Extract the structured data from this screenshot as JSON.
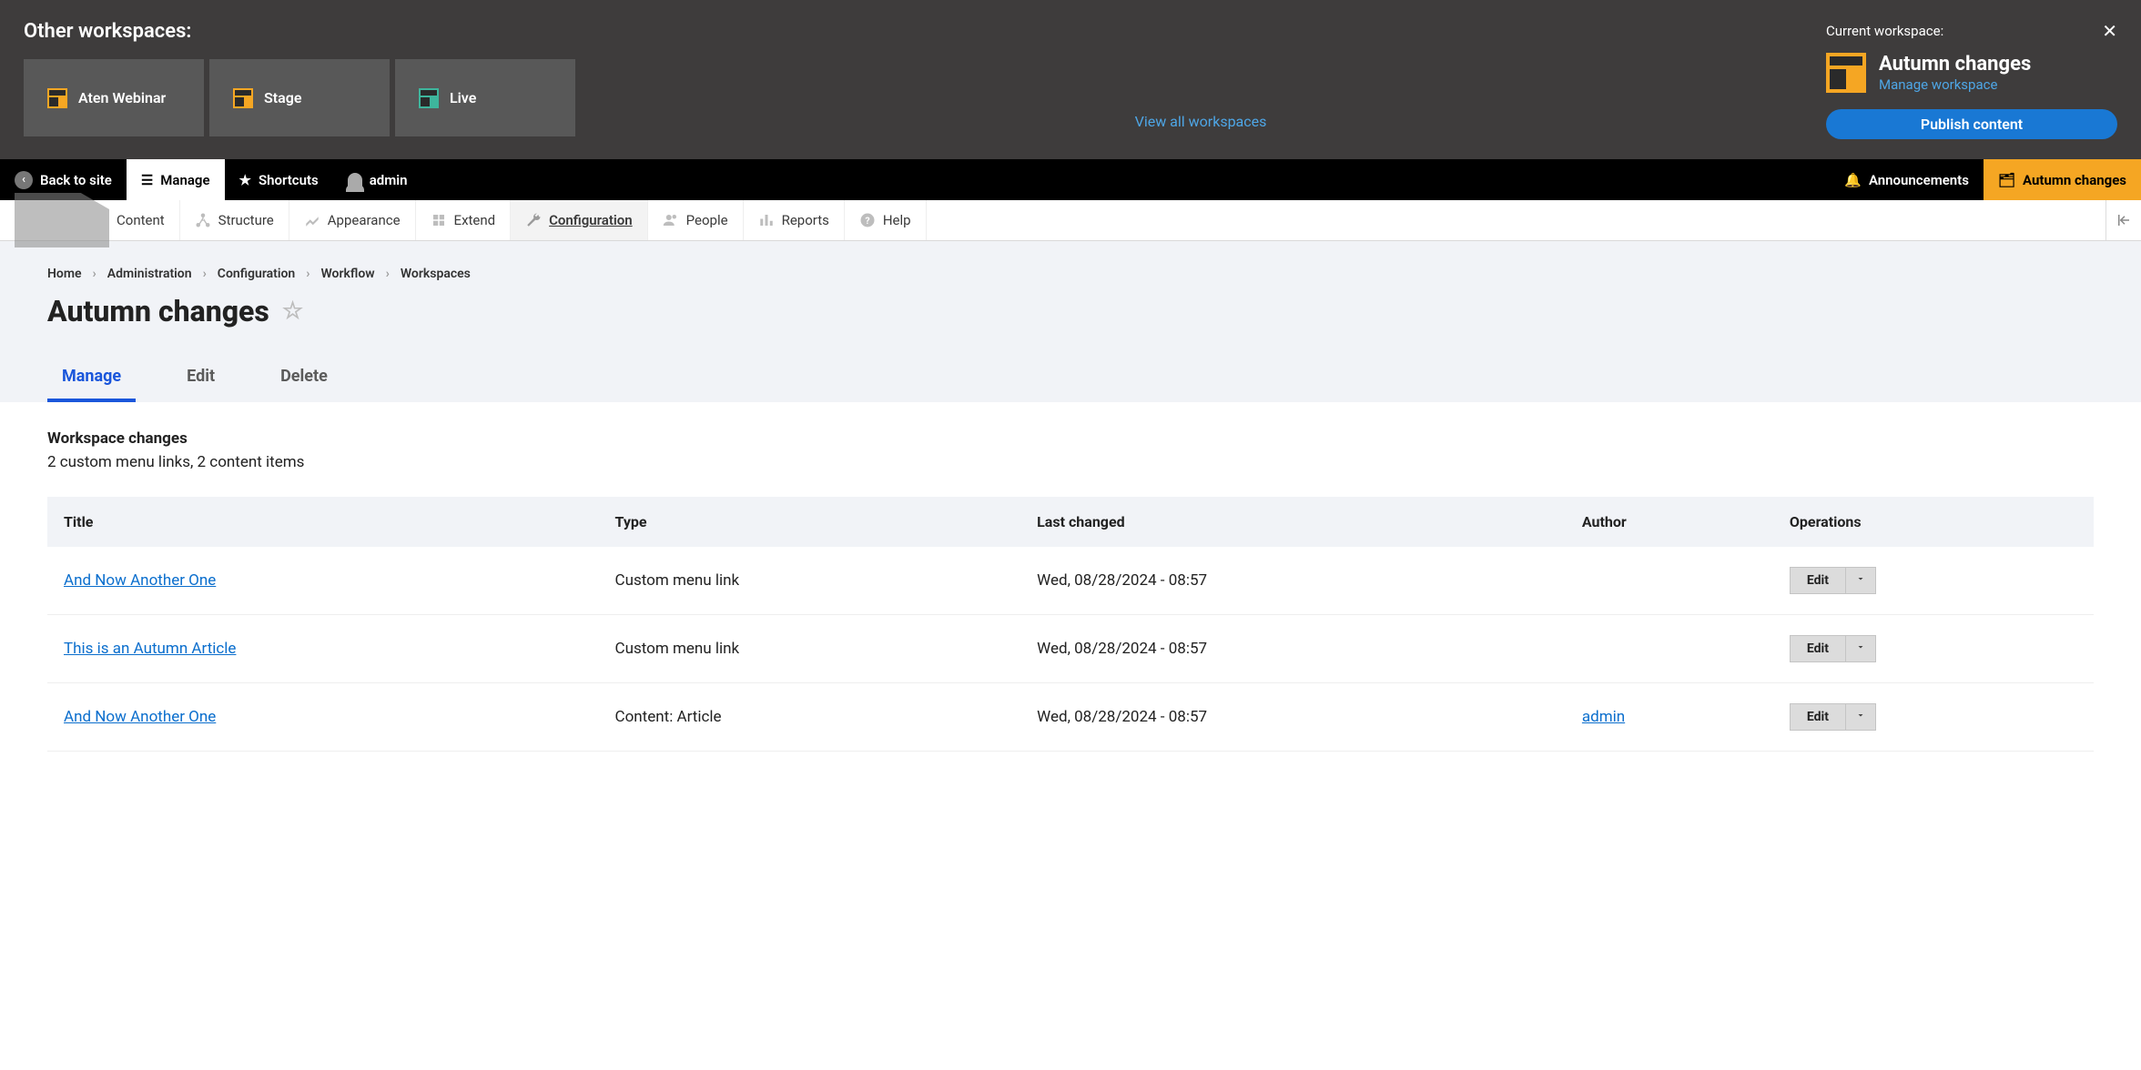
{
  "workspace_panel": {
    "other_title": "Other workspaces:",
    "tiles": [
      "Aten Webinar",
      "Stage",
      "Live"
    ],
    "view_all": "View all workspaces",
    "current_label": "Current workspace:",
    "current_name": "Autumn changes",
    "manage_link": "Manage workspace",
    "publish_btn": "Publish content"
  },
  "toolbar": {
    "back": "Back to site",
    "manage": "Manage",
    "shortcuts": "Shortcuts",
    "user": "admin",
    "announcements": "Announcements",
    "workspace": "Autumn changes"
  },
  "submenu": [
    "Content",
    "Structure",
    "Appearance",
    "Extend",
    "Configuration",
    "People",
    "Reports",
    "Help"
  ],
  "submenu_active": 4,
  "breadcrumbs": [
    "Home",
    "Administration",
    "Configuration",
    "Workflow",
    "Workspaces"
  ],
  "page_title": "Autumn changes",
  "tabs": [
    {
      "label": "Manage",
      "active": true
    },
    {
      "label": "Edit",
      "active": false
    },
    {
      "label": "Delete",
      "active": false
    }
  ],
  "section": {
    "heading": "Workspace changes",
    "summary": "2 custom menu links, 2 content items"
  },
  "table": {
    "headers": [
      "Title",
      "Type",
      "Last changed",
      "Author",
      "Operations"
    ],
    "rows": [
      {
        "title": "And Now Another One",
        "type": "Custom menu link",
        "changed": "Wed, 08/28/2024 - 08:57",
        "author": "",
        "op": "Edit"
      },
      {
        "title": "This is an Autumn Article",
        "type": "Custom menu link",
        "changed": "Wed, 08/28/2024 - 08:57",
        "author": "",
        "op": "Edit"
      },
      {
        "title": "And Now Another One",
        "type": "Content: Article",
        "changed": "Wed, 08/28/2024 - 08:57",
        "author": "admin",
        "op": "Edit"
      }
    ]
  }
}
